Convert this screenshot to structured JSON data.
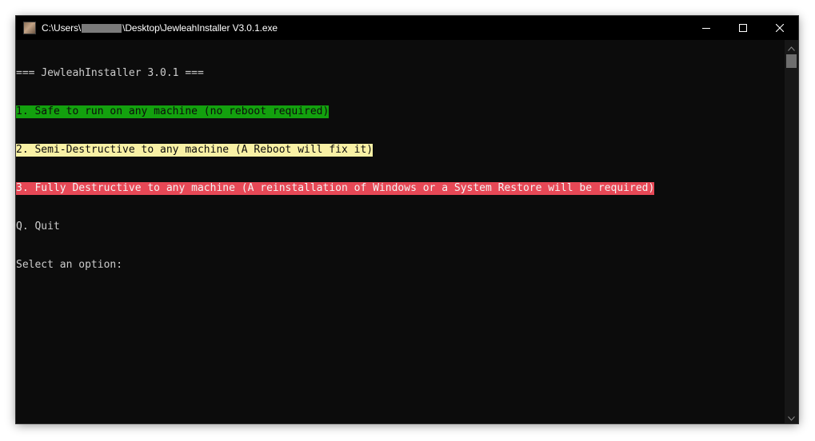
{
  "window": {
    "title_prefix": "C:\\Users\\",
    "title_suffix": "\\Desktop\\JewleahInstaller V3.0.1.exe",
    "colors": {
      "background": "#0c0c0c",
      "text": "#cccccc",
      "option_safe_bg": "#13a10e",
      "option_semi_bg": "#f9f1a5",
      "option_full_bg": "#e74856"
    }
  },
  "controls": {
    "minimize_icon": "minimize-icon",
    "maximize_icon": "maximize-icon",
    "close_icon": "close-icon"
  },
  "console": {
    "header": "=== JewleahInstaller 3.0.1 ===",
    "option_1": "1. Safe to run on any machine (no reboot required)",
    "option_2": "2. Semi-Destructive to any machine (A Reboot will fix it)",
    "option_3": "3. Fully Destructive to any machine (A reinstallation of Windows or a System Restore will be required)",
    "quit": "Q. Quit",
    "prompt": "Select an option:"
  }
}
